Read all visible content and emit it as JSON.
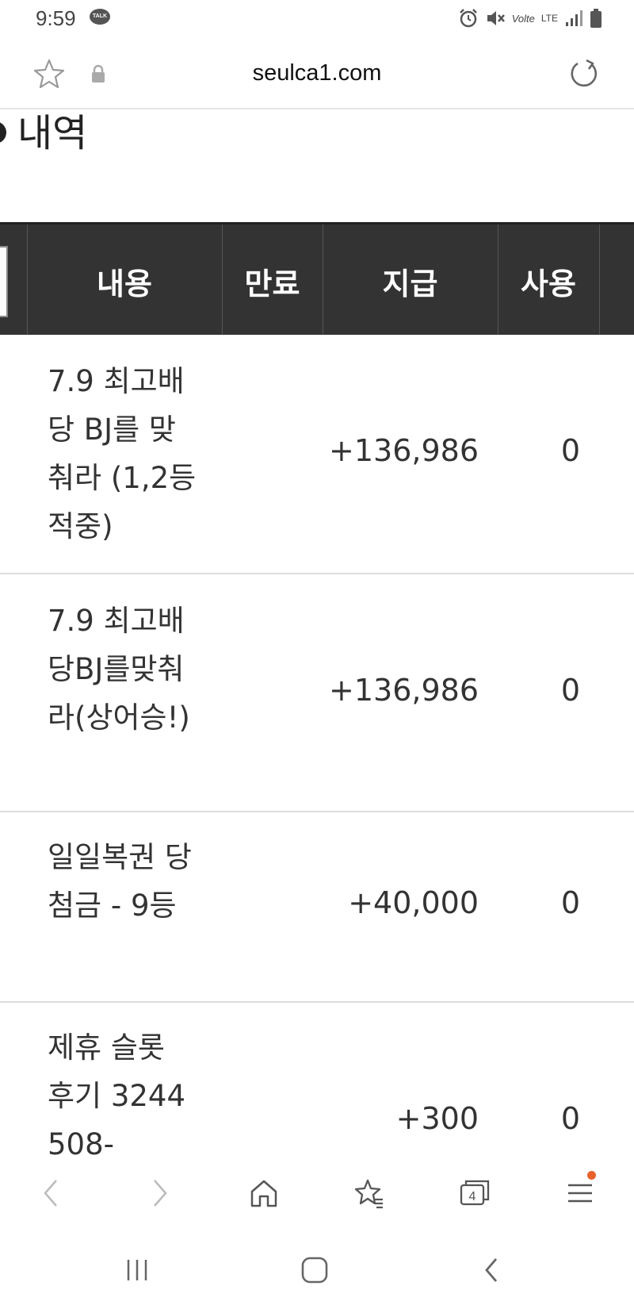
{
  "status_bar": {
    "time": "9:59",
    "talk_badge": "TALK",
    "network": "LTE",
    "volte": "Vo",
    "icons": [
      "talk-icon",
      "alarm-icon",
      "mute-icon",
      "volte-icon",
      "lte-icon",
      "signal-icon",
      "battery-icon"
    ]
  },
  "browser": {
    "url": "seulca1.com",
    "icons": [
      "star-icon",
      "lock-icon",
      "reload-icon"
    ]
  },
  "page": {
    "heading": "내역",
    "table": {
      "headers": [
        "내용",
        "만료",
        "지급",
        "사용"
      ],
      "rows": [
        {
          "desc": "7.9 최고배당 BJ를 맞춰라 (1,2등 적중)",
          "expire": "",
          "pay": "+136,986",
          "use": "0"
        },
        {
          "desc": "7.9 최고배당BJ를맞춰라(상어승!)",
          "expire": "",
          "pay": "+136,986",
          "use": "0"
        },
        {
          "desc": "일일복권 당첨금 - 9등",
          "expire": "",
          "pay": "+40,000",
          "use": "0"
        },
        {
          "desc": "제휴 슬롯 후기 3244508-",
          "expire": "",
          "pay": "+300",
          "use": "0"
        }
      ]
    }
  },
  "toolbar": {
    "tabs_count": "4",
    "icons": [
      "back-icon",
      "forward-icon",
      "home-icon",
      "bookmarks-icon",
      "tabs-icon",
      "menu-icon"
    ]
  },
  "colors": {
    "header_bg": "#333333",
    "notification_dot": "#e8632b"
  }
}
